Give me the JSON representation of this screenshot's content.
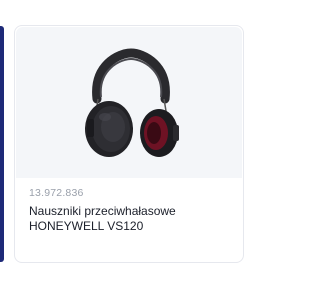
{
  "product": {
    "sku": "13.972.836",
    "title_line1": "Nauszniki przeciwhałasowe",
    "title_line2": "HONEYWELL VS120",
    "image_icon": "earmuffs-image",
    "accent_color": "#1e2a78"
  }
}
